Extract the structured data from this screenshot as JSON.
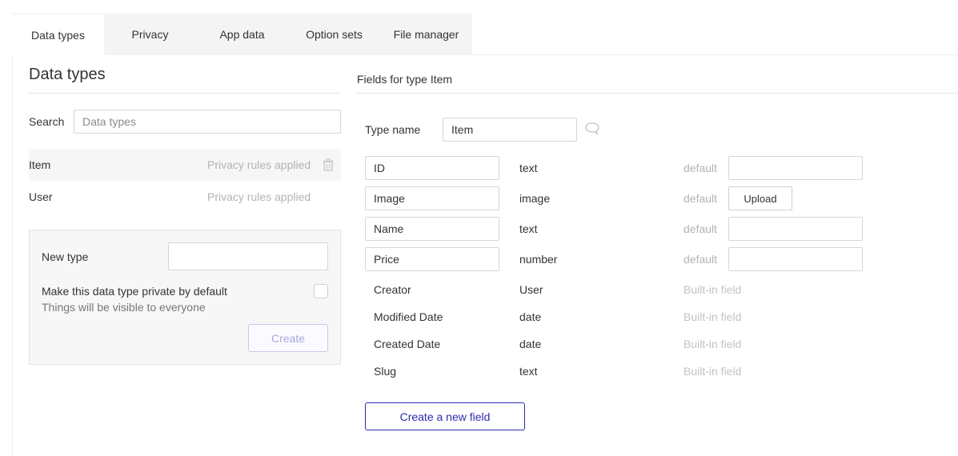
{
  "tabs": [
    {
      "label": "Data types",
      "active": true
    },
    {
      "label": "Privacy",
      "active": false
    },
    {
      "label": "App data",
      "active": false
    },
    {
      "label": "Option sets",
      "active": false
    },
    {
      "label": "File manager",
      "active": false
    }
  ],
  "left": {
    "title": "Data types",
    "search_label": "Search",
    "search_placeholder": "Data types",
    "types": [
      {
        "name": "Item",
        "privacy": "Privacy rules applied",
        "selected": true
      },
      {
        "name": "User",
        "privacy": "Privacy rules applied",
        "selected": false
      }
    ],
    "new_type": {
      "label": "New type",
      "private_label": "Make this data type private by default",
      "private_sub": "Things will be visible to everyone",
      "create_label": "Create"
    }
  },
  "right": {
    "title": "Fields for type Item",
    "type_name_label": "Type name",
    "type_name_value": "Item",
    "default_label": "default",
    "upload_label": "Upload",
    "builtin_label": "Built-in field",
    "editable_fields": [
      {
        "name": "ID",
        "type": "text",
        "default_kind": "input"
      },
      {
        "name": "Image",
        "type": "image",
        "default_kind": "upload"
      },
      {
        "name": "Name",
        "type": "text",
        "default_kind": "input"
      },
      {
        "name": "Price",
        "type": "number",
        "default_kind": "input"
      }
    ],
    "builtin_fields": [
      {
        "name": "Creator",
        "type": "User"
      },
      {
        "name": "Modified Date",
        "type": "date"
      },
      {
        "name": "Created Date",
        "type": "date"
      },
      {
        "name": "Slug",
        "type": "text"
      }
    ],
    "new_field_label": "Create a new field"
  },
  "colors": {
    "accent": "#2d2ab0",
    "muted_text": "#b3b3b3",
    "panel_bg": "#f7f7f7"
  },
  "icons": {
    "trash": "trash-icon",
    "comment": "comment-icon"
  }
}
